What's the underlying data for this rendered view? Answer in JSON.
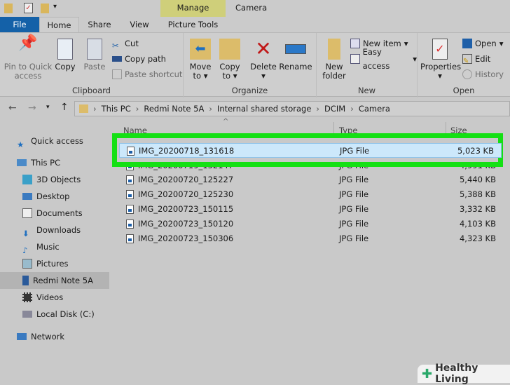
{
  "title_bar": {
    "manage_label": "Manage",
    "window_title": "Camera"
  },
  "tabs": {
    "file": "File",
    "home": "Home",
    "share": "Share",
    "view": "View",
    "picture_tools": "Picture Tools"
  },
  "ribbon": {
    "clipboard": {
      "label": "Clipboard",
      "pin": "Pin to Quick access",
      "copy": "Copy",
      "paste": "Paste",
      "cut": "Cut",
      "copy_path": "Copy path",
      "paste_shortcut": "Paste shortcut"
    },
    "organize": {
      "label": "Organize",
      "move_to": "Move to",
      "copy_to": "Copy to",
      "delete": "Delete",
      "rename": "Rename"
    },
    "new": {
      "label": "New",
      "new_folder": "New folder",
      "new_item": "New item",
      "easy_access": "Easy access"
    },
    "open": {
      "label": "Open",
      "properties": "Properties",
      "open": "Open",
      "edit": "Edit",
      "history": "History"
    }
  },
  "breadcrumb": [
    "This PC",
    "Redmi Note 5A",
    "Internal shared storage",
    "DCIM",
    "Camera"
  ],
  "sidebar": [
    {
      "label": "Quick access"
    },
    {
      "label": "This PC"
    },
    {
      "label": "3D Objects"
    },
    {
      "label": "Desktop"
    },
    {
      "label": "Documents"
    },
    {
      "label": "Downloads"
    },
    {
      "label": "Music"
    },
    {
      "label": "Pictures"
    },
    {
      "label": "Redmi Note 5A"
    },
    {
      "label": "Videos"
    },
    {
      "label": "Local Disk (C:)"
    },
    {
      "label": "Network"
    }
  ],
  "columns": {
    "name": "Name",
    "type": "Type",
    "size": "Size"
  },
  "files": [
    {
      "name": "IMG_20200718_131618",
      "type": "JPG File",
      "size": "5,023 KB"
    },
    {
      "name": "IMG_20200719_132147",
      "type": "JPG File",
      "size": "4,991 KB"
    },
    {
      "name": "IMG_20200720_125227",
      "type": "JPG File",
      "size": "5,440 KB"
    },
    {
      "name": "IMG_20200720_125230",
      "type": "JPG File",
      "size": "5,388 KB"
    },
    {
      "name": "IMG_20200723_150115",
      "type": "JPG File",
      "size": "3,332 KB"
    },
    {
      "name": "IMG_20200723_150120",
      "type": "JPG File",
      "size": "4,103 KB"
    },
    {
      "name": "IMG_20200723_150306",
      "type": "JPG File",
      "size": "4,323 KB"
    }
  ],
  "watermark": "Healthy Living",
  "colors": {
    "highlight": "#14e014",
    "selected": "#cce8fb",
    "file_tab": "#1461a8",
    "manage": "#cfcf7a"
  }
}
